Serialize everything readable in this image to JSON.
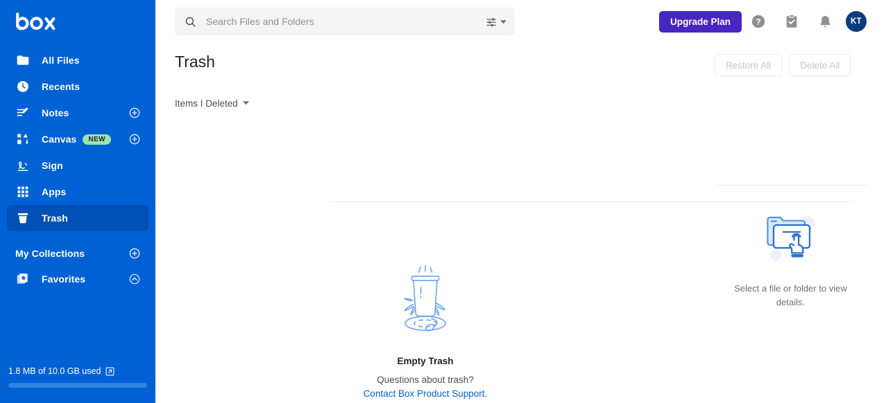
{
  "brand": {
    "logo_text": "box",
    "sidebar_color": "#0061D5",
    "sidebar_selected_color": "#0050B5",
    "accent_link_color": "#0061D5",
    "upgrade_button_color": "#4826C2",
    "avatar_color": "#0D3C7D",
    "badge_color": "#9BE5AE"
  },
  "sidebar": {
    "items": [
      {
        "label": "All Files",
        "icon": "folder-icon",
        "action_icon": "",
        "badge": "",
        "selected": false
      },
      {
        "label": "Recents",
        "icon": "clock-icon",
        "action_icon": "",
        "badge": "",
        "selected": false
      },
      {
        "label": "Notes",
        "icon": "notes-icon",
        "action_icon": "plus-circle-icon",
        "badge": "",
        "selected": false
      },
      {
        "label": "Canvas",
        "icon": "canvas-icon",
        "action_icon": "plus-circle-icon",
        "badge": "NEW",
        "selected": false
      },
      {
        "label": "Sign",
        "icon": "sign-icon",
        "action_icon": "",
        "badge": "",
        "selected": false
      },
      {
        "label": "Apps",
        "icon": "apps-grid-icon",
        "action_icon": "",
        "badge": "",
        "selected": false
      },
      {
        "label": "Trash",
        "icon": "trash-icon",
        "action_icon": "",
        "badge": "",
        "selected": true
      }
    ],
    "collections": {
      "title": "My Collections",
      "add_icon": "plus-circle-icon",
      "items": [
        {
          "label": "Favorites",
          "icon": "favorites-icon",
          "action_icon": "chevron-up-circle-icon"
        }
      ]
    },
    "storage": {
      "text": "1.8 MB of 10.0 GB used",
      "external_icon": "external-link-icon",
      "used_percent": 0.018
    }
  },
  "header": {
    "search": {
      "placeholder": "Search Files and Folders",
      "value": "",
      "search_icon": "search-icon",
      "filter_icon": "sliders-icon",
      "filter_caret_icon": "caret-down-icon"
    },
    "upgrade_label": "Upgrade Plan",
    "icons": [
      {
        "name": "help-icon"
      },
      {
        "name": "clipboard-check-icon"
      },
      {
        "name": "bell-icon"
      }
    ],
    "avatar_initials": "KT"
  },
  "main": {
    "page_title": "Trash",
    "filter_label": "Items I Deleted",
    "filter_caret_icon": "caret-down-icon",
    "empty_state": {
      "illustration": "empty-trash-can-illustration",
      "title": "Empty Trash",
      "question": "Questions about trash?",
      "link_text": "Contact Box Product Support",
      "link_suffix": "."
    }
  },
  "right_panel": {
    "restore_all_label": "Restore All",
    "delete_all_label": "Delete All",
    "restore_all_disabled": true,
    "delete_all_disabled": true,
    "empty": {
      "illustration": "folder-select-illustration",
      "text": "Select a file or folder to view details."
    }
  }
}
